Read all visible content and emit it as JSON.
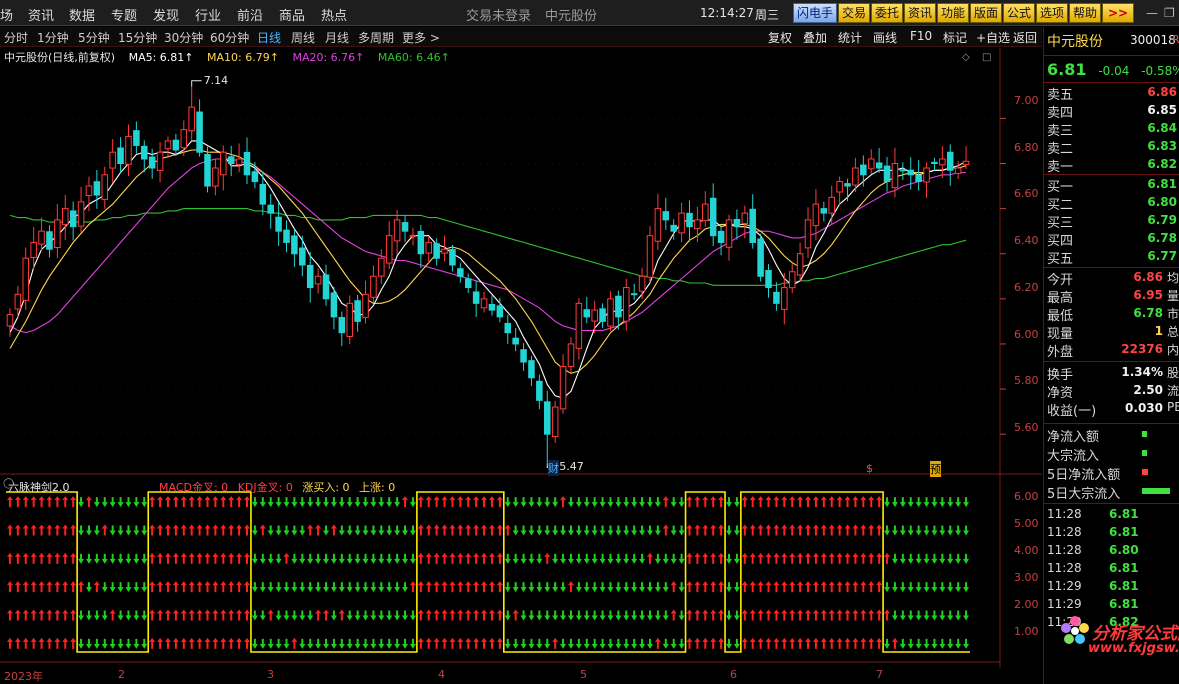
{
  "menu": {
    "items": [
      "场",
      "资讯",
      "数据",
      "专题",
      "发现",
      "行业",
      "前沿",
      "商品",
      "热点"
    ],
    "trade_status": "交易未登录",
    "stock_name": "中元股份",
    "time": "12:14:27",
    "weekday": "周三",
    "buttons": [
      "闪电手",
      "交易",
      "委托",
      "资讯",
      "功能",
      "版面",
      "公式",
      "选项",
      "帮助",
      ">>"
    ]
  },
  "toolbar": {
    "periods": [
      "分时",
      "1分钟",
      "5分钟",
      "15分钟",
      "30分钟",
      "60分钟",
      "日线",
      "周线",
      "月线",
      "多周期",
      "更多 >"
    ],
    "active_period": "日线",
    "tools": [
      "复权",
      "叠加",
      "统计",
      "画线",
      "F10",
      "标记",
      "+自选",
      "返回"
    ]
  },
  "main_chart": {
    "title": "中元股份(日线,前复权)",
    "ma5": "MA5: 6.81↑",
    "ma10": "MA10: 6.79↑",
    "ma20": "MA20: 6.76↑",
    "ma60": "MA60: 6.46↑",
    "high_label": "7.14",
    "low_label": "5.47",
    "marker_cai": "财",
    "marker_dollar": "$",
    "marker_yu": "预",
    "y_ticks": [
      "7.00",
      "6.80",
      "6.60",
      "6.40",
      "6.20",
      "6.00",
      "5.80",
      "5.60"
    ],
    "x_ticks": [
      "2023年",
      "2",
      "3",
      "4",
      "5",
      "6",
      "7"
    ]
  },
  "indicator": {
    "title": "六脉神剑2.0",
    "macd": "MACD金叉: 0",
    "kdj": "KDJ金叉: 0",
    "zmr": "涨买入: 0",
    "sz": "上涨: 0",
    "y_ticks": [
      "6.00",
      "5.00",
      "4.00",
      "3.00",
      "2.00",
      "1.00"
    ]
  },
  "chart_data": {
    "type": "candlestick",
    "title": "中元股份(日线,前复权)",
    "ylim": [
      5.45,
      7.25
    ],
    "high": 7.14,
    "low": 5.47,
    "ma_latest": {
      "MA5": 6.81,
      "MA10": 6.79,
      "MA20": 6.76,
      "MA60": 6.46
    },
    "closes": [
      6.13,
      6.22,
      6.38,
      6.45,
      6.5,
      6.42,
      6.55,
      6.6,
      6.52,
      6.63,
      6.7,
      6.66,
      6.75,
      6.85,
      6.8,
      6.92,
      6.88,
      6.82,
      6.78,
      6.85,
      6.9,
      6.86,
      6.95,
      7.05,
      6.85,
      6.7,
      6.78,
      6.85,
      6.8,
      6.82,
      6.75,
      6.72,
      6.62,
      6.58,
      6.5,
      6.45,
      6.4,
      6.35,
      6.25,
      6.3,
      6.2,
      6.12,
      6.05,
      6.18,
      6.1,
      6.22,
      6.3,
      6.38,
      6.48,
      6.55,
      6.5,
      6.48,
      6.4,
      6.45,
      6.38,
      6.42,
      6.35,
      6.3,
      6.25,
      6.18,
      6.2,
      6.15,
      6.12,
      6.05,
      6.0,
      5.92,
      5.85,
      5.75,
      5.6,
      5.72,
      5.9,
      6.0,
      6.18,
      6.12,
      6.15,
      6.1,
      6.2,
      6.12,
      6.25,
      6.22,
      6.3,
      6.48,
      6.6,
      6.55,
      6.5,
      6.58,
      6.52,
      6.55,
      6.62,
      6.48,
      6.45,
      6.55,
      6.52,
      6.58,
      6.45,
      6.3,
      6.25,
      6.18,
      6.25,
      6.32,
      6.4,
      6.55,
      6.62,
      6.58,
      6.65,
      6.72,
      6.7,
      6.78,
      6.75,
      6.82,
      6.78,
      6.72,
      6.8,
      6.77,
      6.75,
      6.72,
      6.78,
      6.8,
      6.82,
      6.77,
      6.78,
      6.81
    ],
    "ma5": [
      6.05,
      6.12,
      6.22,
      6.34,
      6.42,
      6.45,
      6.48,
      6.52,
      6.56,
      6.58,
      6.62,
      6.64,
      6.66,
      6.71,
      6.76,
      6.8,
      6.84,
      6.85,
      6.84,
      6.85,
      6.85,
      6.84,
      6.86,
      6.9,
      6.9,
      6.88,
      6.86,
      6.84,
      6.79,
      6.79,
      6.8,
      6.78,
      6.74,
      6.69,
      6.63,
      6.57,
      6.51,
      6.46,
      6.39,
      6.35,
      6.3,
      6.24,
      6.18,
      6.16,
      6.13,
      6.13,
      6.17,
      6.24,
      6.3,
      6.39,
      6.44,
      6.48,
      6.48,
      6.48,
      6.44,
      6.43,
      6.4,
      6.38,
      6.34,
      6.3,
      6.26,
      6.22,
      6.18,
      6.14,
      6.1,
      6.03,
      5.97,
      5.91,
      5.82,
      5.77,
      5.76,
      5.79,
      5.88,
      5.98,
      6.07,
      6.11,
      6.15,
      6.14,
      6.16,
      6.18,
      6.22,
      6.27,
      6.37,
      6.43,
      6.49,
      6.54,
      6.55,
      6.54,
      6.55,
      6.55,
      6.52,
      6.53,
      6.52,
      6.52,
      6.51,
      6.48,
      6.42,
      6.35,
      6.29,
      6.26,
      6.28,
      6.34,
      6.43,
      6.49,
      6.56,
      6.62,
      6.65,
      6.69,
      6.72,
      6.75,
      6.77,
      6.77,
      6.77,
      6.78,
      6.76,
      6.75,
      6.76,
      6.77,
      6.77,
      6.78,
      6.79,
      6.81
    ],
    "ma10": [
      5.98,
      6.04,
      6.1,
      6.17,
      6.24,
      6.3,
      6.35,
      6.4,
      6.45,
      6.49,
      6.53,
      6.56,
      6.59,
      6.62,
      6.66,
      6.7,
      6.74,
      6.77,
      6.8,
      6.82,
      6.83,
      6.84,
      6.85,
      6.86,
      6.86,
      6.85,
      6.85,
      6.85,
      6.84,
      6.83,
      6.81,
      6.79,
      6.76,
      6.73,
      6.7,
      6.66,
      6.62,
      6.58,
      6.53,
      6.48,
      6.43,
      6.38,
      6.33,
      6.28,
      6.24,
      6.2,
      6.18,
      6.18,
      6.19,
      6.21,
      6.24,
      6.28,
      6.32,
      6.36,
      6.4,
      6.42,
      6.43,
      6.42,
      6.4,
      6.37,
      6.34,
      6.31,
      6.28,
      6.24,
      6.2,
      6.15,
      6.1,
      6.04,
      5.98,
      5.92,
      5.89,
      5.87,
      5.88,
      5.91,
      5.95,
      6.0,
      6.05,
      6.08,
      6.11,
      6.14,
      6.18,
      6.22,
      6.28,
      6.33,
      6.38,
      6.42,
      6.46,
      6.48,
      6.51,
      6.52,
      6.53,
      6.53,
      6.53,
      6.53,
      6.52,
      6.5,
      6.47,
      6.43,
      6.39,
      6.36,
      6.34,
      6.35,
      6.37,
      6.4,
      6.44,
      6.49,
      6.54,
      6.59,
      6.63,
      6.67,
      6.7,
      6.72,
      6.74,
      6.75,
      6.76,
      6.76,
      6.76,
      6.77,
      6.77,
      6.78,
      6.78,
      6.79
    ],
    "ma20": [
      6.08,
      6.06,
      6.05,
      6.06,
      6.08,
      6.1,
      6.13,
      6.17,
      6.21,
      6.25,
      6.29,
      6.33,
      6.37,
      6.41,
      6.45,
      6.49,
      6.53,
      6.57,
      6.61,
      6.65,
      6.69,
      6.72,
      6.75,
      6.78,
      6.8,
      6.81,
      6.82,
      6.82,
      6.82,
      6.81,
      6.8,
      6.78,
      6.76,
      6.74,
      6.71,
      6.68,
      6.65,
      6.62,
      6.59,
      6.56,
      6.53,
      6.5,
      6.47,
      6.45,
      6.43,
      6.41,
      6.4,
      6.39,
      6.38,
      6.37,
      6.37,
      6.36,
      6.35,
      6.34,
      6.33,
      6.32,
      6.31,
      6.3,
      6.29,
      6.28,
      6.27,
      6.26,
      6.25,
      6.24,
      6.22,
      6.2,
      6.18,
      6.16,
      6.13,
      6.1,
      6.08,
      6.07,
      6.06,
      6.06,
      6.06,
      6.06,
      6.07,
      6.08,
      6.1,
      6.12,
      6.14,
      6.17,
      6.2,
      6.23,
      6.26,
      6.29,
      6.32,
      6.35,
      6.38,
      6.41,
      6.43,
      6.45,
      6.47,
      6.49,
      6.5,
      6.5,
      6.5,
      6.49,
      6.48,
      6.47,
      6.47,
      6.48,
      6.49,
      6.51,
      6.53,
      6.55,
      6.57,
      6.59,
      6.61,
      6.63,
      6.65,
      6.67,
      6.68,
      6.7,
      6.71,
      6.72,
      6.73,
      6.74,
      6.75,
      6.75,
      6.76,
      6.76
    ],
    "ma60": [
      6.57,
      6.56,
      6.56,
      6.55,
      6.55,
      6.54,
      6.54,
      6.54,
      6.54,
      6.54,
      6.54,
      6.55,
      6.55,
      6.56,
      6.56,
      6.57,
      6.57,
      6.58,
      6.58,
      6.58,
      6.59,
      6.59,
      6.6,
      6.6,
      6.6,
      6.6,
      6.6,
      6.6,
      6.6,
      6.6,
      6.6,
      6.59,
      6.59,
      6.58,
      6.58,
      6.57,
      6.57,
      6.56,
      6.56,
      6.55,
      6.55,
      6.55,
      6.55,
      6.56,
      6.56,
      6.56,
      6.57,
      6.57,
      6.57,
      6.57,
      6.57,
      6.57,
      6.57,
      6.56,
      6.56,
      6.55,
      6.54,
      6.53,
      6.52,
      6.51,
      6.5,
      6.49,
      6.48,
      6.47,
      6.46,
      6.45,
      6.44,
      6.43,
      6.42,
      6.41,
      6.4,
      6.39,
      6.38,
      6.37,
      6.36,
      6.35,
      6.34,
      6.33,
      6.32,
      6.31,
      6.3,
      6.3,
      6.29,
      6.29,
      6.28,
      6.28,
      6.27,
      6.27,
      6.27,
      6.26,
      6.26,
      6.26,
      6.26,
      6.26,
      6.26,
      6.26,
      6.26,
      6.26,
      6.27,
      6.27,
      6.28,
      6.28,
      6.29,
      6.29,
      6.3,
      6.31,
      6.32,
      6.33,
      6.34,
      6.35,
      6.36,
      6.37,
      6.38,
      6.39,
      6.4,
      6.41,
      6.42,
      6.43,
      6.44,
      6.44,
      6.45,
      6.46
    ],
    "indicator_ylim": [
      0.5,
      6.5
    ],
    "indicator_rows": 6,
    "indicator_red_ranges": [
      [
        0,
        8
      ],
      [
        18,
        30
      ],
      [
        52,
        62
      ],
      [
        86,
        90
      ],
      [
        93,
        110
      ]
    ]
  },
  "quote": {
    "name": "中元股份",
    "code": "300018",
    "code_suffix": "R",
    "price": "6.81",
    "change": "-0.04",
    "change_pct": "-0.58%",
    "asks": [
      {
        "label": "卖五",
        "price": "6.86"
      },
      {
        "label": "卖四",
        "price": "6.85"
      },
      {
        "label": "卖三",
        "price": "6.84"
      },
      {
        "label": "卖二",
        "price": "6.83"
      },
      {
        "label": "卖一",
        "price": "6.82"
      }
    ],
    "bids": [
      {
        "label": "买一",
        "price": "6.81"
      },
      {
        "label": "买二",
        "price": "6.80"
      },
      {
        "label": "买三",
        "price": "6.79"
      },
      {
        "label": "买四",
        "price": "6.78"
      },
      {
        "label": "买五",
        "price": "6.77"
      }
    ],
    "stats": [
      {
        "label": "今开",
        "value": "6.86",
        "extra": "均"
      },
      {
        "label": "最高",
        "value": "6.95",
        "extra": "量"
      },
      {
        "label": "最低",
        "value": "6.78",
        "extra": "市"
      },
      {
        "label": "现量",
        "value": "1",
        "extra": "总"
      },
      {
        "label": "外盘",
        "value": "22376",
        "extra": "内"
      }
    ],
    "stats2": [
      {
        "label": "换手",
        "value": "1.34%",
        "extra": "股"
      },
      {
        "label": "净资",
        "value": "2.50",
        "extra": "流"
      },
      {
        "label": "收益(一)",
        "value": "0.030",
        "extra": "PE"
      }
    ],
    "flows": [
      "净流入额",
      "大宗流入",
      "5日净流入额",
      "5日大宗流入"
    ],
    "ticks": [
      {
        "time": "11:28",
        "price": "6.81"
      },
      {
        "time": "11:28",
        "price": "6.81"
      },
      {
        "time": "11:28",
        "price": "6.80"
      },
      {
        "time": "11:28",
        "price": "6.81"
      },
      {
        "time": "11:29",
        "price": "6.81"
      },
      {
        "time": "11:29",
        "price": "6.81"
      },
      {
        "time": "11:29",
        "price": "6.82"
      }
    ]
  },
  "watermark": {
    "line1": "分析家公式网",
    "line2": "www.fxjgsw.com"
  },
  "colors": {
    "up": "#ff3b3b",
    "down": "#22d4d4",
    "ma5": "#ffffff",
    "ma10": "#ffd84a",
    "ma20": "#e040e0",
    "ma60": "#30c030",
    "arrow_red": "#ff2020",
    "arrow_green": "#20d020",
    "indicator_line": "#ffee00"
  }
}
